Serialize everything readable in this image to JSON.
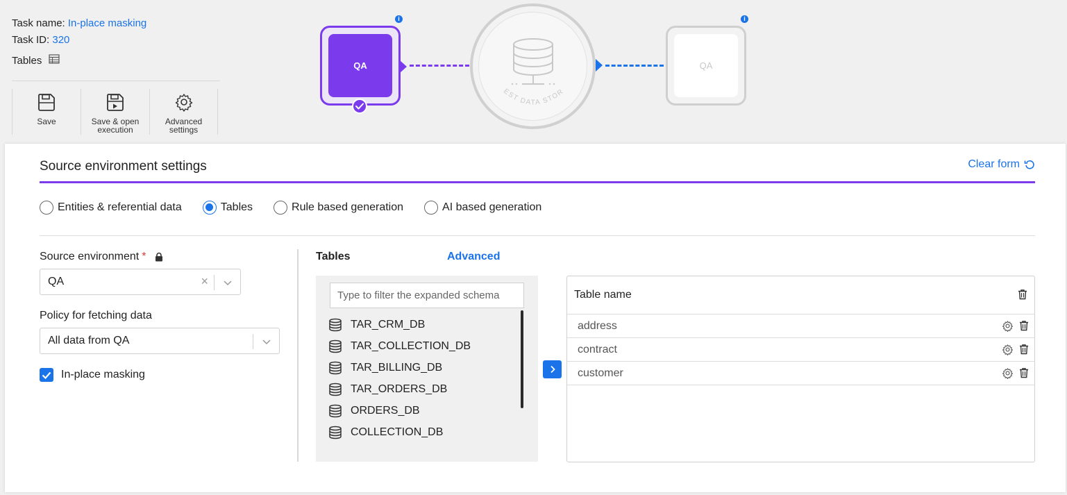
{
  "header": {
    "task_name_label": "Task name:",
    "task_name_value": "In-place masking",
    "task_id_label": "Task ID:",
    "task_id_value": "320",
    "tables_label": "Tables"
  },
  "toolbar": {
    "save_label": "Save",
    "save_open_label_1": "Save & open",
    "save_open_label_2": "execution",
    "advanced_label_1": "Advanced",
    "advanced_label_2": "settings"
  },
  "flow": {
    "source_node_label": "QA",
    "store_label": "TEST DATA STORE",
    "target_node_label": "QA",
    "colors": {
      "source": "#7c3aed",
      "target_link": "#1a73e8",
      "inactive": "#cfcfcf"
    }
  },
  "panel": {
    "title": "Source environment settings",
    "clear_form": "Clear form",
    "radios": {
      "entities": "Entities & referential data",
      "tables": "Tables",
      "rule": "Rule based generation",
      "ai": "AI based generation"
    },
    "selected_radio": "Tables",
    "source_env_label": "Source environment",
    "source_env_required": "*",
    "source_env_value": "QA",
    "policy_label": "Policy for fetching data",
    "policy_value": "All data from QA",
    "inplace_masking_label": "In-place masking",
    "inplace_masking_checked": true
  },
  "tables_section": {
    "header": "Tables",
    "advanced_link": "Advanced",
    "filter_placeholder": "Type to filter the expanded schema",
    "schemas": [
      "TAR_CRM_DB",
      "TAR_COLLECTION_DB",
      "TAR_BILLING_DB",
      "TAR_ORDERS_DB",
      "ORDERS_DB",
      "COLLECTION_DB"
    ],
    "table_header": "Table name",
    "selected_tables": [
      "address",
      "contract",
      "customer"
    ]
  },
  "colors": {
    "accent": "#1a73e8",
    "brand": "#7c3aed",
    "required": "#e53935"
  }
}
